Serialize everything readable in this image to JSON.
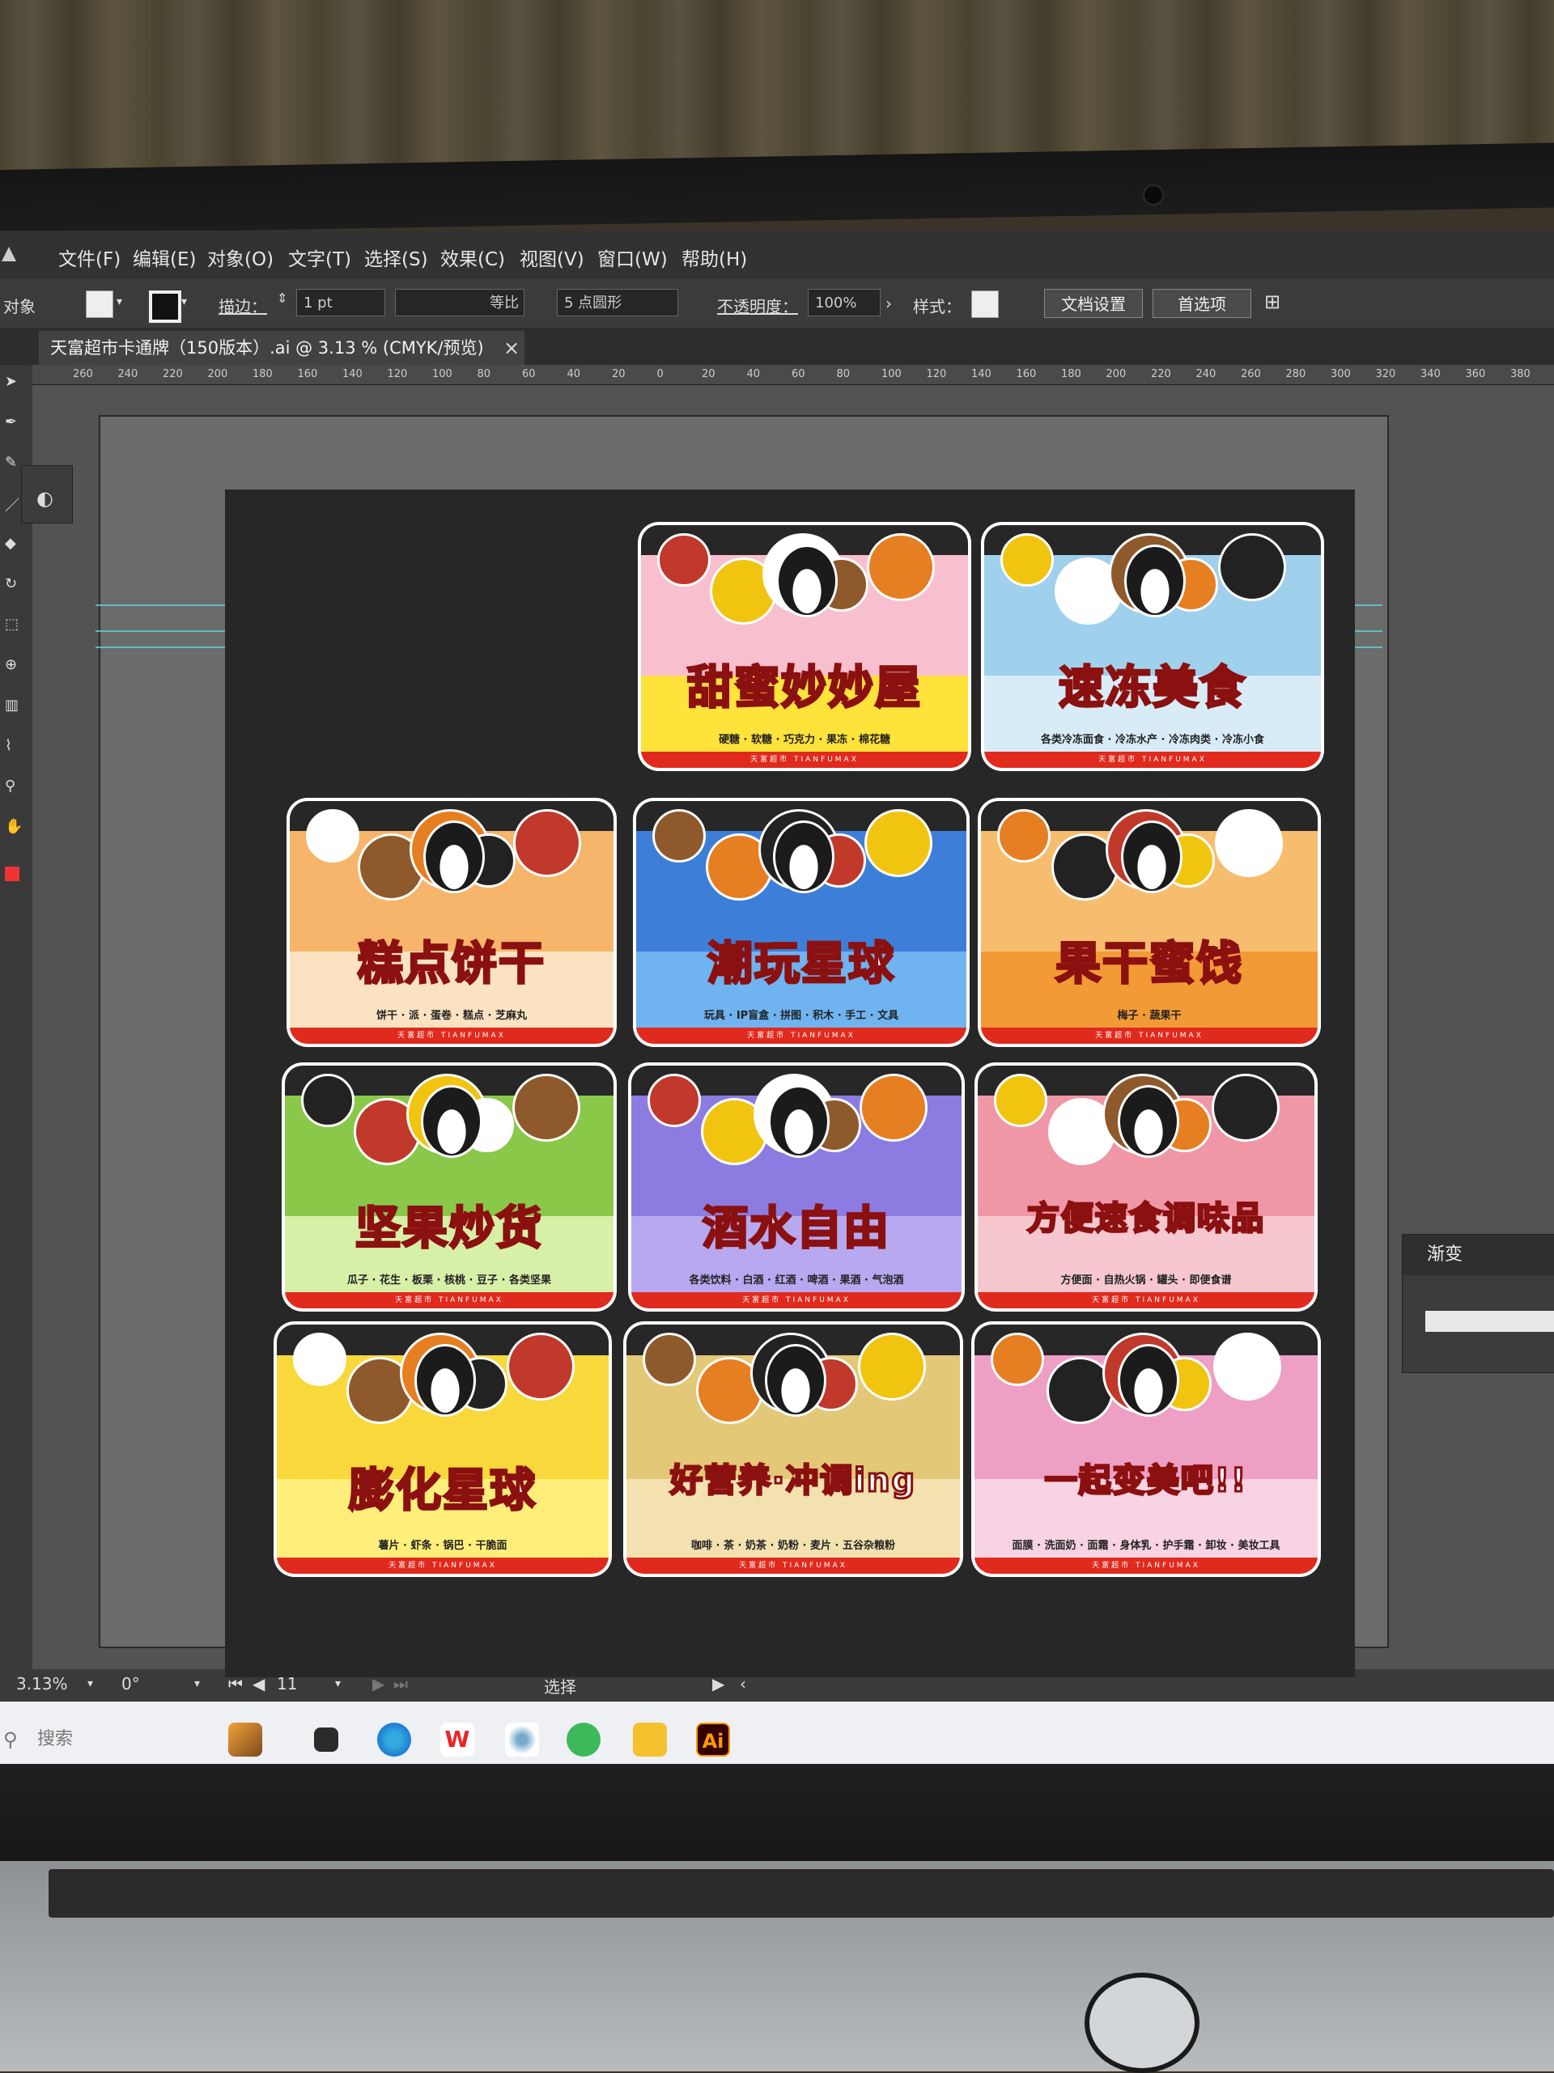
{
  "menu": {
    "items": [
      "文件(F)",
      "编辑(E)",
      "对象(O)",
      "文字(T)",
      "选择(S)",
      "效果(C)",
      "视图(V)",
      "窗口(W)",
      "帮助(H)"
    ]
  },
  "control_bar": {
    "left_label": "对象",
    "stroke_label": "描边：",
    "stroke_value": "1 pt",
    "profile_label": "等比",
    "brush_label": "5 点圆形",
    "opacity_label": "不透明度：",
    "opacity_value": "100%",
    "style_label": "样式：",
    "doc_setup_button": "文档设置",
    "prefs_button": "首选项"
  },
  "document_tab": {
    "title": "天富超市卡通牌（150版本）.ai @ 3.13 % (CMYK/预览)",
    "close": "×"
  },
  "ruler": {
    "ticks": [
      "260",
      "240",
      "220",
      "200",
      "180",
      "160",
      "140",
      "120",
      "100",
      "80",
      "60",
      "40",
      "20",
      "0",
      "20",
      "40",
      "60",
      "80",
      "100",
      "120",
      "140",
      "160",
      "180",
      "200",
      "220",
      "240",
      "260",
      "280",
      "300",
      "320",
      "340",
      "360",
      "380"
    ]
  },
  "signs": [
    {
      "title": "甜蜜妙妙屋",
      "subtitle": "硬糖 · 软糖 · 巧克力 · 果冻 · 棉花糖",
      "footer": "天富超市 TIANFUMAX",
      "bg": "#ffe23a",
      "band": "#f8c0cf"
    },
    {
      "title": "速冻美食",
      "subtitle": "各类冷冻面食 · 冷冻水产 · 冷冻肉类 · 冷冻小食",
      "footer": "天富超市 TIANFUMAX",
      "bg": "#d8ecf8",
      "band": "#9fd0ec"
    },
    {
      "title": "糕点饼干",
      "subtitle": "饼干 · 派 · 蛋卷 · 糕点 · 芝麻丸",
      "footer": "天富超市 TIANFUMAX",
      "bg": "#fbe3c2",
      "band": "#f6b56a"
    },
    {
      "title": "潮玩星球",
      "subtitle": "玩具 · IP盲盒 · 拼图 · 积木 · 手工 · 文具",
      "footer": "天富超市 TIANFUMAX",
      "bg": "#6fb3f0",
      "band": "#3d7fd8"
    },
    {
      "title": "果干蜜饯",
      "subtitle": "梅子 · 蔬果干",
      "footer": "天富超市 TIANFUMAX",
      "bg": "#f29a36",
      "band": "#f7bd6e"
    },
    {
      "title": "坚果炒货",
      "subtitle": "瓜子 · 花生 · 板栗 · 核桃 · 豆子 · 各类坚果",
      "footer": "天富超市 TIANFUMAX",
      "bg": "#d7f0a8",
      "band": "#8ac84a"
    },
    {
      "title": "酒水自由",
      "subtitle": "各类饮料 · 白酒 · 红酒 · 啤酒 · 果酒 · 气泡酒",
      "footer": "天富超市 TIANFUMAX",
      "bg": "#b7a8f0",
      "band": "#8c7be0"
    },
    {
      "title": "方便速食调味品",
      "subtitle": "方便面 · 自热火锅 · 罐头 · 即便食谱",
      "footer": "天富超市 TIANFUMAX",
      "bg": "#f7c7d0",
      "band": "#ef97a6"
    },
    {
      "title": "膨化星球",
      "subtitle": "薯片 · 虾条 · 锅巴 · 干脆面",
      "footer": "天富超市 TIANFUMAX",
      "bg": "#ffef7a",
      "band": "#f8d83a"
    },
    {
      "title": "好营养·冲调ing",
      "subtitle": "咖啡 · 茶 · 奶茶 · 奶粉 · 麦片 · 五谷杂粮粉",
      "footer": "天富超市 TIANFUMAX",
      "bg": "#f3e2b0",
      "band": "#e3c878"
    },
    {
      "title": "一起变美吧!!",
      "subtitle": "面膜 · 洗面奶 · 面霜 · 身体乳 · 护手霜 · 卸妆 · 美妆工具",
      "footer": "天富超市 TIANFUMAX",
      "bg": "#f8d3e3",
      "band": "#ee9fc4"
    }
  ],
  "status_bar": {
    "zoom": "3.13%",
    "rotation": "0°",
    "artboard_number": "11",
    "mode": "选择"
  },
  "right_panel": {
    "title": "渐变"
  },
  "taskbar": {
    "search_placeholder": "搜索",
    "ai_label": "Ai"
  }
}
